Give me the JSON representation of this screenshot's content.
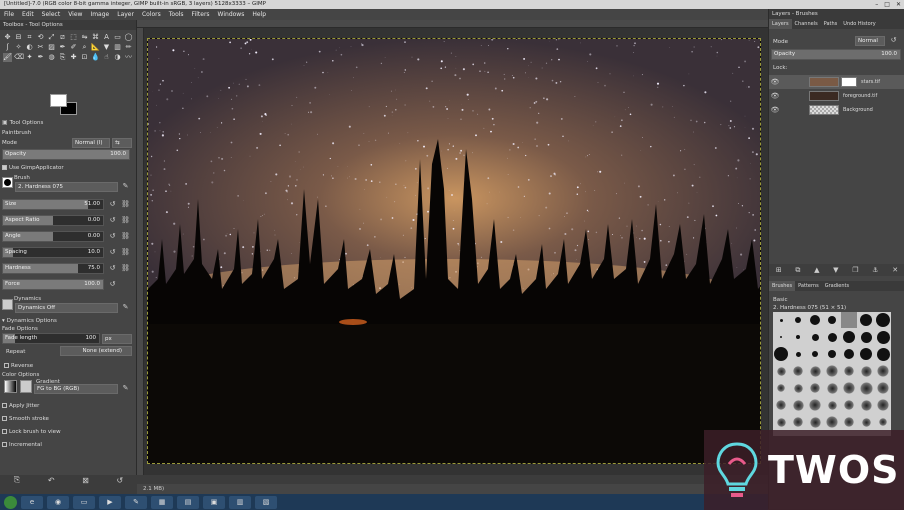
{
  "window": {
    "title": "[Untitled]-7.0 (RGB color 8-bit gamma integer, GIMP built-in sRGB, 3 layers) 5128x3333 – GIMP",
    "controls": [
      "–",
      "□",
      "✕"
    ]
  },
  "menu": [
    "File",
    "Edit",
    "Select",
    "View",
    "Image",
    "Layer",
    "Colors",
    "Tools",
    "Filters",
    "Windows",
    "Help"
  ],
  "toolbox": {
    "title": "Toolbox - Tool Options",
    "tool_icons": [
      "move-tool",
      "align-tool",
      "crop-tool",
      "rotate-tool",
      "scale-tool",
      "shear-tool",
      "perspective-tool",
      "flip-tool",
      "cage-tool",
      "text-tool",
      "rect-select-tool",
      "ellipse-select-tool",
      "free-select-tool",
      "fuzzy-select-tool",
      "color-select-tool",
      "scissors-tool",
      "foreground-select-tool",
      "paths-tool",
      "color-picker-tool",
      "zoom-tool",
      "measure-tool",
      "bucket-fill-tool",
      "blend-tool",
      "pencil-tool",
      "paintbrush-tool",
      "eraser-tool",
      "airbrush-tool",
      "ink-tool",
      "mypaint-tool",
      "clone-tool",
      "heal-tool",
      "perspective-clone-tool",
      "blur-tool",
      "smudge-tool",
      "dodge-burn-tool",
      "warp-tool"
    ],
    "tool_options_tab": "Tool Options",
    "tool_name": "Paintbrush",
    "mode_label": "Mode",
    "mode_value": "Normal (l)",
    "opacity_label": "Opacity",
    "opacity_value": "100.0",
    "opacity_fraction": 1.0,
    "use_applicator": "Use GimpApplicator",
    "brush_label": "Brush",
    "brush_value": "2. Hardness 075",
    "size_label": "Size",
    "size_value": "51.00",
    "size_fraction": 0.85,
    "aspect_label": "Aspect Ratio",
    "aspect_value": "0.00",
    "aspect_fraction": 0.5,
    "angle_label": "Angle",
    "angle_value": "0.00",
    "angle_fraction": 0.5,
    "spacing_label": "Spacing",
    "spacing_value": "10.0",
    "spacing_fraction": 0.1,
    "hardness_label": "Hardness",
    "hardness_value": "75.0",
    "hardness_fraction": 0.75,
    "force_label": "Force",
    "force_value": "100.0",
    "force_fraction": 1.0,
    "dynamics_label": "Dynamics",
    "dynamics_value": "Dynamics Off",
    "dynamics_options": "Dynamics Options",
    "fade_options": "Fade Options",
    "fade_length_label": "Fade length",
    "fade_length_value": "100",
    "fade_unit": "px",
    "repeat_label": "Repeat",
    "repeat_value": "None (extend)",
    "reverse_label": "Reverse",
    "color_options": "Color Options",
    "gradient_label": "Gradient",
    "gradient_value": "FG to BG (RGB)",
    "apply_jitter": "Apply Jitter",
    "smooth_stroke": "Smooth stroke",
    "lock_brush": "Lock brush to view",
    "incremental": "Incremental"
  },
  "statusbar": {
    "text": "2.1 MB)"
  },
  "right_dock": {
    "title": "Layers - Brushes",
    "tabs": [
      "Layers",
      "Channels",
      "Paths",
      "Undo History"
    ],
    "mode_label": "Mode",
    "mode_value": "Normal",
    "opacity_label": "Opacity",
    "opacity_value": "100.0",
    "lock_label": "Lock:",
    "layers": [
      {
        "name": "stars.tif",
        "thumb": "#7a5a45"
      },
      {
        "name": "foreground.tif",
        "thumb": "#3b2a22"
      },
      {
        "name": "Background",
        "thumb": "#cfcfcf"
      }
    ],
    "brush_tabs": [
      "Brushes",
      "Patterns",
      "Gradients"
    ],
    "brush_selected_name": "2. Hardness 075 (51 × 51)",
    "brush_filter": "Basic"
  },
  "taskbar": {
    "items": [
      "start",
      "ie",
      "chrome",
      "folder",
      "media",
      "gimp",
      "app1",
      "app2",
      "app3",
      "app4",
      "app5"
    ]
  },
  "watermark": {
    "text": "TWOS"
  }
}
